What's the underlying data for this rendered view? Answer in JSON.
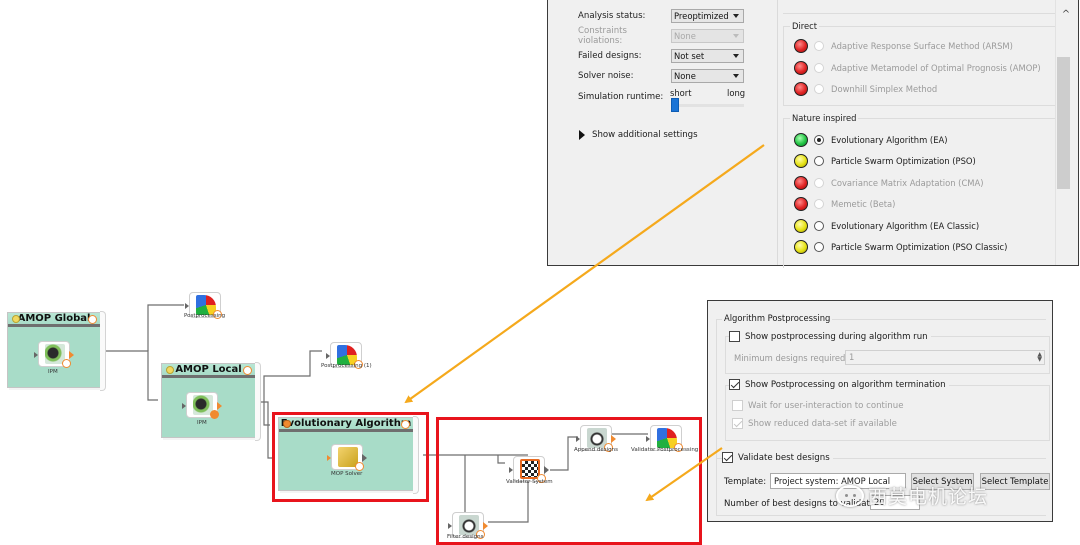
{
  "settings_panel": {
    "fields": [
      {
        "label": "Analysis status:",
        "value": "Preoptimized",
        "disabled": false
      },
      {
        "label": "Constraints violations:",
        "value": "None",
        "disabled": true
      },
      {
        "label": "Failed designs:",
        "value": "Not set",
        "disabled": false
      },
      {
        "label": "Solver noise:",
        "value": "None",
        "disabled": false
      }
    ],
    "runtime": {
      "label": "Simulation runtime:",
      "min_label": "short",
      "max_label": "long",
      "value_fraction": 0.0
    },
    "show_more": "Show additional settings",
    "groups": [
      {
        "title": "Direct",
        "items": [
          {
            "label": "Adaptive Response Surface Method (ARSM)",
            "status": "red",
            "selected": false,
            "disabled": true
          },
          {
            "label": "Adaptive Metamodel of Optimal Prognosis (AMOP)",
            "status": "red",
            "selected": false,
            "disabled": true
          },
          {
            "label": "Downhill Simplex Method",
            "status": "red",
            "selected": false,
            "disabled": true
          }
        ]
      },
      {
        "title": "Nature inspired",
        "items": [
          {
            "label": "Evolutionary Algorithm (EA)",
            "status": "green",
            "selected": true,
            "disabled": false
          },
          {
            "label": "Particle Swarm Optimization (PSO)",
            "status": "yellow",
            "selected": false,
            "disabled": false
          },
          {
            "label": "Covariance Matrix Adaptation (CMA)",
            "status": "red",
            "selected": false,
            "disabled": true
          },
          {
            "label": "Memetic (Beta)",
            "status": "red",
            "selected": false,
            "disabled": true
          },
          {
            "label": "Evolutionary Algorithm (EA Classic)",
            "status": "yellow",
            "selected": false,
            "disabled": false
          },
          {
            "label": "Particle Swarm Optimization (PSO Classic)",
            "status": "yellow",
            "selected": false,
            "disabled": false
          }
        ]
      }
    ],
    "scroll_up_icon": "^"
  },
  "postprocessing_panel": {
    "group_title": "Algorithm Postprocessing",
    "show_during_run": {
      "label": "Show postprocessing during algorithm run",
      "checked": false
    },
    "min_designs": {
      "label": "Minimum designs required:",
      "value": "1"
    },
    "show_on_termination": {
      "label": "Show Postprocessing on algorithm termination",
      "checked": true
    },
    "wait_user": {
      "label": "Wait for user-interaction to continue",
      "checked": false,
      "disabled": true
    },
    "reduced_dataset": {
      "label": "Show reduced data-set if available",
      "checked": true,
      "disabled": true
    },
    "validate": {
      "label": "Validate best designs",
      "checked": true
    },
    "template_label": "Template:",
    "template_value": "Project system: AMOP Local",
    "select_system": "Select System",
    "select_template": "Select Template",
    "nbest_label": "Number of best designs to validate:",
    "nbest_value": "20"
  },
  "watermark": "西莫电机论坛",
  "workflow": {
    "systems": [
      {
        "title": "AMOP Global",
        "node_label": "IPM"
      },
      {
        "title": "AMOP Local",
        "node_label": "IPM"
      },
      {
        "title": "Evolutionary Algorithm",
        "node_label": "MOP Solver"
      }
    ],
    "nodes": {
      "postprocessing": "Postprocessing",
      "postprocessing_1": "Postprocessing (1)",
      "validator_system": "Validator System",
      "append_designs": "Append designs",
      "validator_postprocessing": "Validator Postprocessing",
      "filter_designs": "Filter designs"
    }
  },
  "colors": {
    "highlight": "#e8141c",
    "arrow": "#f5a91c",
    "system_fill": "#a8dcc8"
  }
}
